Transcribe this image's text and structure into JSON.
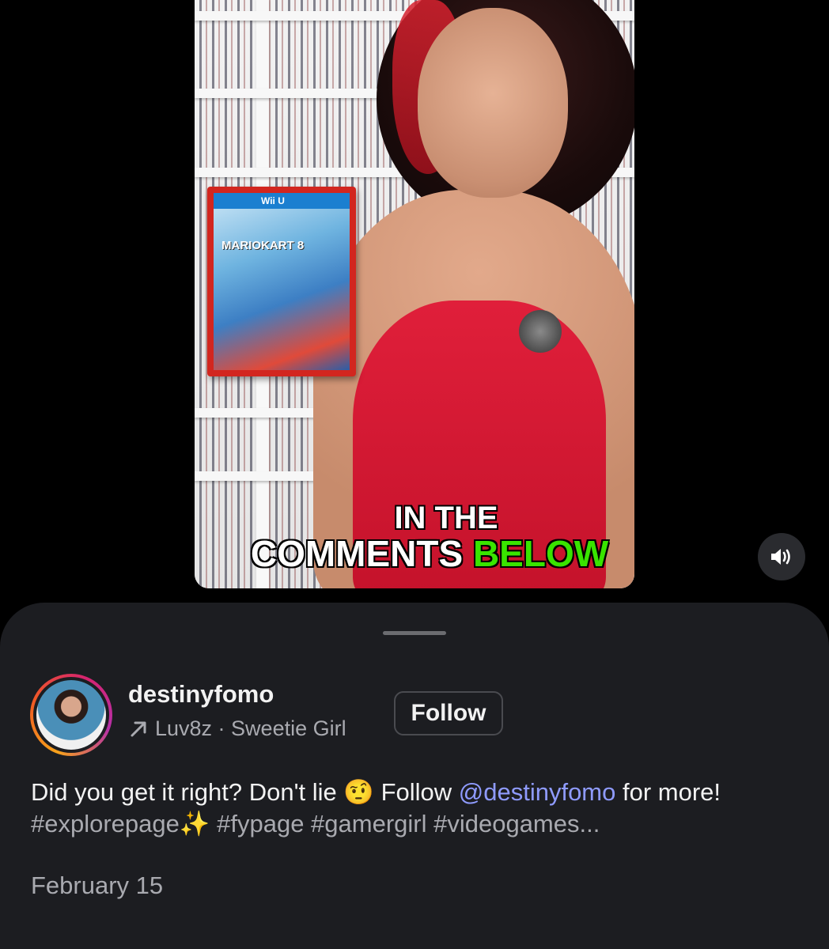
{
  "video": {
    "caption_line1": "IN THE",
    "caption_line2_white": "COMMENTS",
    "caption_line2_green": "BELOW",
    "game_box_brand": "Wii U",
    "game_box_title": "MARIOKART 8"
  },
  "controls": {
    "mute_icon": "speaker-volume-icon"
  },
  "post": {
    "username": "destinyfomo",
    "audio_arrow_icon": "arrow-up-right-icon",
    "audio_label": "Luv8z · Sweetie Girl",
    "follow_label": "Follow",
    "caption_part1": "Did you get it right? Don't lie ",
    "caption_emoji": "🤨",
    "caption_part2": " Follow ",
    "caption_mention": "@destinyfomo",
    "caption_part3": " for more! ",
    "caption_hashtag1": "#explorepage",
    "caption_sparkle": "✨",
    "caption_hashtags": " #fypage #gamergirl #videogames...",
    "date": "February 15"
  },
  "colors": {
    "sheet_bg": "#1c1d21",
    "link": "#8f9bff",
    "caption_green": "#39e400"
  }
}
